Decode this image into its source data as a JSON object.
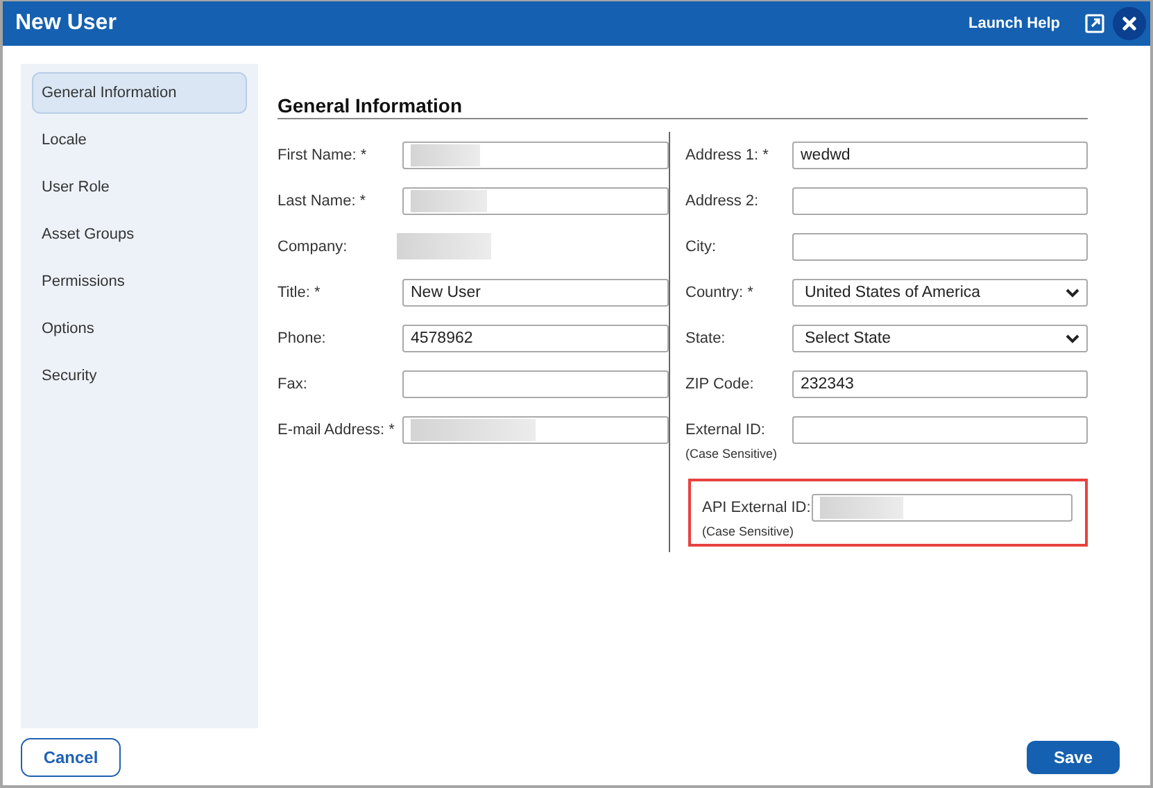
{
  "window": {
    "title": "New User"
  },
  "header": {
    "help_link": "Launch Help"
  },
  "sidebar": {
    "items": [
      {
        "label": "General Information",
        "selected": true
      },
      {
        "label": "Locale",
        "selected": false
      },
      {
        "label": "User Role",
        "selected": false
      },
      {
        "label": "Asset Groups",
        "selected": false
      },
      {
        "label": "Permissions",
        "selected": false
      },
      {
        "label": "Options",
        "selected": false
      },
      {
        "label": "Security",
        "selected": false
      }
    ]
  },
  "section_title": "General Information",
  "left_fields": [
    {
      "label": "First Name: *",
      "kind": "input",
      "redacted": true
    },
    {
      "label": "Last Name: *",
      "kind": "input",
      "redacted": true
    },
    {
      "label": "Company:",
      "kind": "text",
      "redacted": true
    },
    {
      "label": "Title: *",
      "kind": "input",
      "value": "New User"
    },
    {
      "label": "Phone:",
      "kind": "input",
      "value": "4578962"
    },
    {
      "label": "Fax:",
      "kind": "input"
    },
    {
      "label": "E-mail Address: *",
      "kind": "input",
      "redacted": true
    }
  ],
  "right_fields": [
    {
      "label": "Address 1: *",
      "kind": "input",
      "value": "wedwd"
    },
    {
      "label": "Address 2:",
      "kind": "input"
    },
    {
      "label": "City:",
      "kind": "input"
    },
    {
      "label": "Country: *",
      "kind": "select",
      "value": "United States of America"
    },
    {
      "label": "State:",
      "kind": "select",
      "value": "Select State"
    },
    {
      "label": "ZIP Code:",
      "kind": "input",
      "value": "232343"
    },
    {
      "label": "External ID:",
      "note": "(Case Sensitive)",
      "kind": "input"
    },
    {
      "label": "API External ID:",
      "note": "(Case Sensitive)",
      "kind": "input",
      "redacted": true,
      "highlighted": true
    }
  ],
  "buttons": {
    "cancel": "Cancel",
    "save": "Save"
  }
}
